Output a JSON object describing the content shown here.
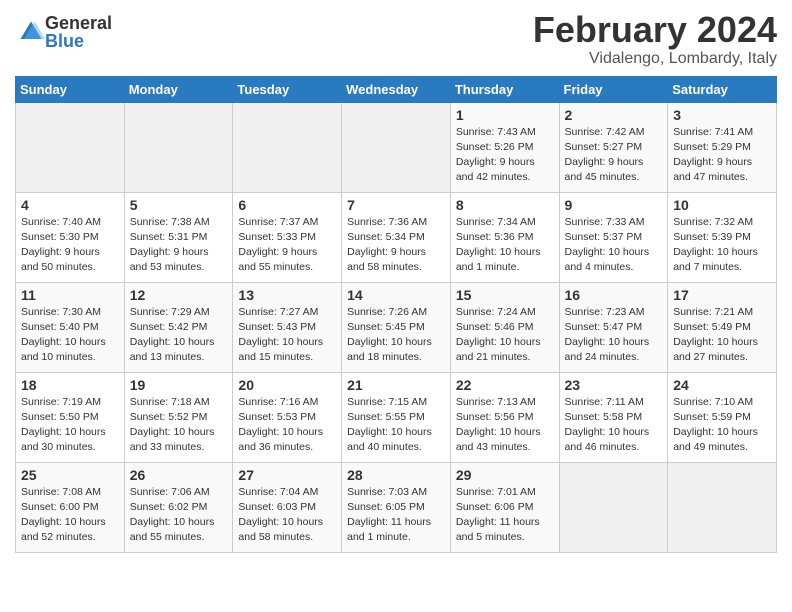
{
  "logo": {
    "general": "General",
    "blue": "Blue"
  },
  "title": "February 2024",
  "location": "Vidalengo, Lombardy, Italy",
  "days_of_week": [
    "Sunday",
    "Monday",
    "Tuesday",
    "Wednesday",
    "Thursday",
    "Friday",
    "Saturday"
  ],
  "weeks": [
    [
      {
        "day": "",
        "info": ""
      },
      {
        "day": "",
        "info": ""
      },
      {
        "day": "",
        "info": ""
      },
      {
        "day": "",
        "info": ""
      },
      {
        "day": "1",
        "info": "Sunrise: 7:43 AM\nSunset: 5:26 PM\nDaylight: 9 hours\nand 42 minutes."
      },
      {
        "day": "2",
        "info": "Sunrise: 7:42 AM\nSunset: 5:27 PM\nDaylight: 9 hours\nand 45 minutes."
      },
      {
        "day": "3",
        "info": "Sunrise: 7:41 AM\nSunset: 5:29 PM\nDaylight: 9 hours\nand 47 minutes."
      }
    ],
    [
      {
        "day": "4",
        "info": "Sunrise: 7:40 AM\nSunset: 5:30 PM\nDaylight: 9 hours\nand 50 minutes."
      },
      {
        "day": "5",
        "info": "Sunrise: 7:38 AM\nSunset: 5:31 PM\nDaylight: 9 hours\nand 53 minutes."
      },
      {
        "day": "6",
        "info": "Sunrise: 7:37 AM\nSunset: 5:33 PM\nDaylight: 9 hours\nand 55 minutes."
      },
      {
        "day": "7",
        "info": "Sunrise: 7:36 AM\nSunset: 5:34 PM\nDaylight: 9 hours\nand 58 minutes."
      },
      {
        "day": "8",
        "info": "Sunrise: 7:34 AM\nSunset: 5:36 PM\nDaylight: 10 hours\nand 1 minute."
      },
      {
        "day": "9",
        "info": "Sunrise: 7:33 AM\nSunset: 5:37 PM\nDaylight: 10 hours\nand 4 minutes."
      },
      {
        "day": "10",
        "info": "Sunrise: 7:32 AM\nSunset: 5:39 PM\nDaylight: 10 hours\nand 7 minutes."
      }
    ],
    [
      {
        "day": "11",
        "info": "Sunrise: 7:30 AM\nSunset: 5:40 PM\nDaylight: 10 hours\nand 10 minutes."
      },
      {
        "day": "12",
        "info": "Sunrise: 7:29 AM\nSunset: 5:42 PM\nDaylight: 10 hours\nand 13 minutes."
      },
      {
        "day": "13",
        "info": "Sunrise: 7:27 AM\nSunset: 5:43 PM\nDaylight: 10 hours\nand 15 minutes."
      },
      {
        "day": "14",
        "info": "Sunrise: 7:26 AM\nSunset: 5:45 PM\nDaylight: 10 hours\nand 18 minutes."
      },
      {
        "day": "15",
        "info": "Sunrise: 7:24 AM\nSunset: 5:46 PM\nDaylight: 10 hours\nand 21 minutes."
      },
      {
        "day": "16",
        "info": "Sunrise: 7:23 AM\nSunset: 5:47 PM\nDaylight: 10 hours\nand 24 minutes."
      },
      {
        "day": "17",
        "info": "Sunrise: 7:21 AM\nSunset: 5:49 PM\nDaylight: 10 hours\nand 27 minutes."
      }
    ],
    [
      {
        "day": "18",
        "info": "Sunrise: 7:19 AM\nSunset: 5:50 PM\nDaylight: 10 hours\nand 30 minutes."
      },
      {
        "day": "19",
        "info": "Sunrise: 7:18 AM\nSunset: 5:52 PM\nDaylight: 10 hours\nand 33 minutes."
      },
      {
        "day": "20",
        "info": "Sunrise: 7:16 AM\nSunset: 5:53 PM\nDaylight: 10 hours\nand 36 minutes."
      },
      {
        "day": "21",
        "info": "Sunrise: 7:15 AM\nSunset: 5:55 PM\nDaylight: 10 hours\nand 40 minutes."
      },
      {
        "day": "22",
        "info": "Sunrise: 7:13 AM\nSunset: 5:56 PM\nDaylight: 10 hours\nand 43 minutes."
      },
      {
        "day": "23",
        "info": "Sunrise: 7:11 AM\nSunset: 5:58 PM\nDaylight: 10 hours\nand 46 minutes."
      },
      {
        "day": "24",
        "info": "Sunrise: 7:10 AM\nSunset: 5:59 PM\nDaylight: 10 hours\nand 49 minutes."
      }
    ],
    [
      {
        "day": "25",
        "info": "Sunrise: 7:08 AM\nSunset: 6:00 PM\nDaylight: 10 hours\nand 52 minutes."
      },
      {
        "day": "26",
        "info": "Sunrise: 7:06 AM\nSunset: 6:02 PM\nDaylight: 10 hours\nand 55 minutes."
      },
      {
        "day": "27",
        "info": "Sunrise: 7:04 AM\nSunset: 6:03 PM\nDaylight: 10 hours\nand 58 minutes."
      },
      {
        "day": "28",
        "info": "Sunrise: 7:03 AM\nSunset: 6:05 PM\nDaylight: 11 hours\nand 1 minute."
      },
      {
        "day": "29",
        "info": "Sunrise: 7:01 AM\nSunset: 6:06 PM\nDaylight: 11 hours\nand 5 minutes."
      },
      {
        "day": "",
        "info": ""
      },
      {
        "day": "",
        "info": ""
      }
    ]
  ]
}
